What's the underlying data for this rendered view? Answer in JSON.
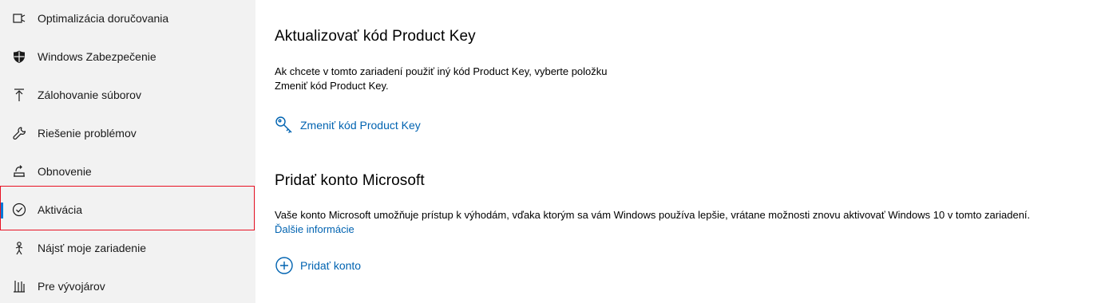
{
  "sidebar": {
    "items": [
      {
        "label": "Optimalizácia doručovania",
        "icon": "delivery-optimization-icon"
      },
      {
        "label": "Windows Zabezpečenie",
        "icon": "shield-icon"
      },
      {
        "label": "Zálohovanie súborov",
        "icon": "backup-arrow-icon"
      },
      {
        "label": "Riešenie problémov",
        "icon": "wrench-icon"
      },
      {
        "label": "Obnovenie",
        "icon": "recovery-icon"
      },
      {
        "label": "Aktivácia",
        "icon": "check-circle-icon",
        "selected": true
      },
      {
        "label": "Nájsť moje zariadenie",
        "icon": "find-device-icon"
      },
      {
        "label": "Pre vývojárov",
        "icon": "developer-icon"
      }
    ]
  },
  "main": {
    "product_key": {
      "title": "Aktualizovať kód Product Key",
      "description_line1": "Ak chcete v tomto zariadení použiť iný kód Product Key, vyberte položku",
      "description_line2": "Zmeniť kód Product Key.",
      "action_label": "Zmeniť kód Product Key",
      "action_icon": "key-icon"
    },
    "microsoft_account": {
      "title": "Pridať konto Microsoft",
      "description": "Vaše konto Microsoft umožňuje prístup k výhodám, vďaka ktorým sa vám Windows používa lepšie, vrátane možnosti znovu aktivovať Windows 10 v tomto zariadení.",
      "more_info_link": "Ďalšie informácie",
      "action_label": "Pridať konto",
      "action_icon": "add-circle-icon"
    }
  },
  "colors": {
    "sidebar_bg": "#f2f2f2",
    "accent": "#0078d7",
    "link": "#0063b1",
    "highlight": "#e81123"
  }
}
